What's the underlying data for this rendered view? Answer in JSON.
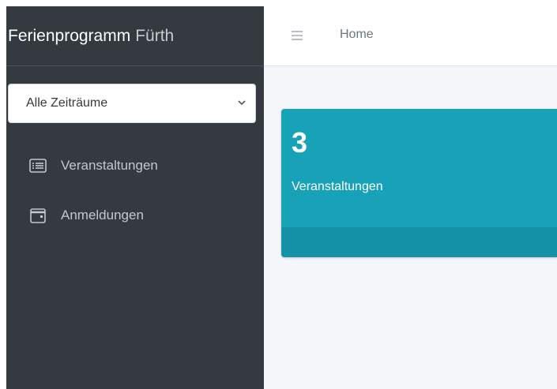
{
  "app": {
    "brand_main": "Ferienprogramm",
    "brand_sub": "Fürth"
  },
  "sidebar": {
    "period_select": {
      "selected": "Alle Zeiträume"
    },
    "items": [
      {
        "label": "Veranstaltungen",
        "icon": "list-icon"
      },
      {
        "label": "Anmeldungen",
        "icon": "calendar-icon"
      }
    ]
  },
  "topbar": {
    "menu_icon": "hamburger-icon",
    "breadcrumb_home": "Home"
  },
  "dashboard": {
    "info_box": {
      "count": "3",
      "label": "Veranstaltungen"
    }
  },
  "colors": {
    "sidebar_bg": "#343a40",
    "info_box_bg": "#17a2b8",
    "content_bg": "#f4f6f9"
  }
}
